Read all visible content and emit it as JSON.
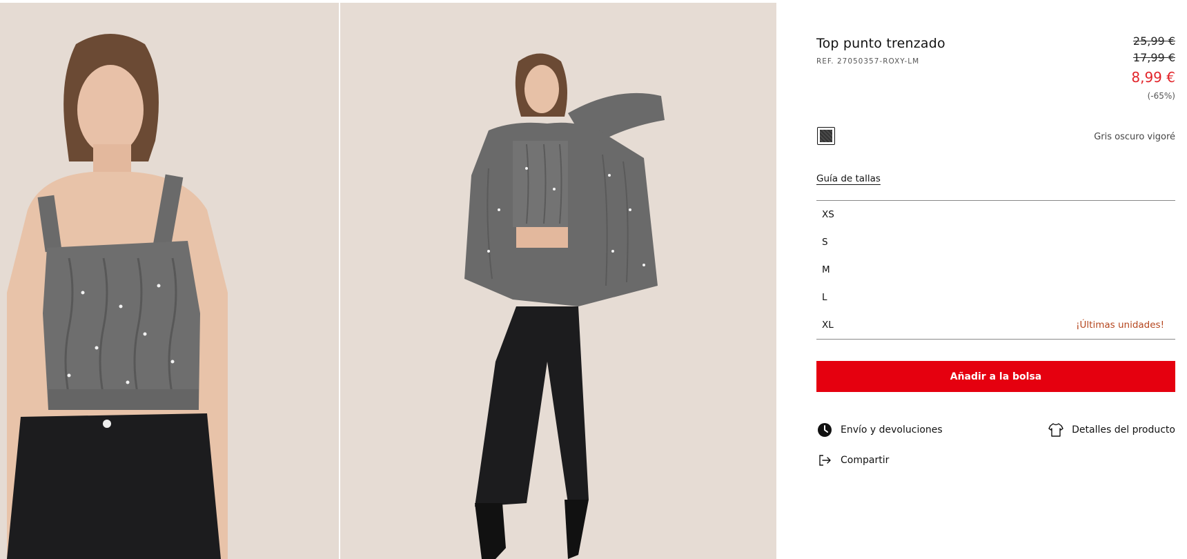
{
  "product": {
    "title": "Top punto trenzado",
    "ref": "REF. 27050357-ROXY-LM",
    "price_original": "25,99 €",
    "price_previous": "17,99 €",
    "price_current": "8,99 €",
    "discount": "(-65%)",
    "color_name": "Gris oscuro vigoré",
    "size_guide_label": "Guía de tallas",
    "sizes": [
      {
        "label": "XS",
        "note": ""
      },
      {
        "label": "S",
        "note": ""
      },
      {
        "label": "M",
        "note": ""
      },
      {
        "label": "L",
        "note": ""
      },
      {
        "label": "XL",
        "note": "¡Últimas unidades!"
      }
    ],
    "add_to_bag_label": "Añadir a la bolsa"
  },
  "links": {
    "shipping": "Envío y devoluciones",
    "details": "Detalles del producto",
    "share": "Compartir"
  },
  "icons": {
    "shipping": "clock-icon",
    "details": "tshirt-icon",
    "share": "share-icon"
  },
  "colors": {
    "accent": "#e5000f",
    "sale_price": "#e2242a",
    "low_stock": "#b5461e",
    "swatch": "#3e3e3e"
  }
}
